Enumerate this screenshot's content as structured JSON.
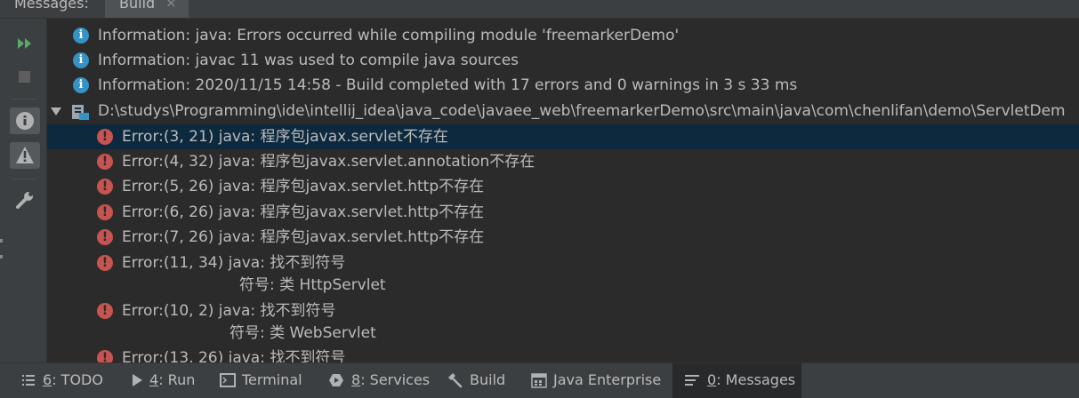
{
  "header": {
    "title": "Messages:",
    "tab_label": "Build",
    "tab_close": "×"
  },
  "toolbar": {
    "buttons": [
      {
        "name": "rerun",
        "icon": "run-double-arrow-icon",
        "color": "#59a869"
      },
      {
        "name": "stop",
        "icon": "stop-icon",
        "color": "#5e5e5e"
      },
      {
        "name": "show-info",
        "icon": "info-icon",
        "selected": true
      },
      {
        "name": "show-warnings",
        "icon": "warning-icon",
        "selected": true
      },
      {
        "name": "settings",
        "icon": "wrench-icon"
      }
    ]
  },
  "messages": {
    "info": [
      {
        "text": "Information: java: Errors occurred while compiling module 'freemarkerDemo'"
      },
      {
        "text": "Information: javac 11 was used to compile java sources"
      },
      {
        "text": "Information: 2020/11/15 14:58 - Build completed with 17 errors and 0 warnings in 3 s 33 ms"
      }
    ],
    "file_path": "D:\\studys\\Programming\\ide\\intellij_idea\\java_code\\javaee_web\\freemarkerDemo\\src\\main\\java\\com\\chenlifan\\demo\\ServletDem",
    "errors": [
      {
        "text": "Error:(3, 21)  java: 程序包javax.servlet不存在",
        "selected": true
      },
      {
        "text": "Error:(4, 32)  java: 程序包javax.servlet.annotation不存在"
      },
      {
        "text": "Error:(5, 26)  java: 程序包javax.servlet.http不存在"
      },
      {
        "text": "Error:(6, 26)  java: 程序包javax.servlet.http不存在"
      },
      {
        "text": "Error:(7, 26)  java: 程序包javax.servlet.http不存在"
      },
      {
        "text": "Error:(11, 34)  java: 找不到符号",
        "continuation": "符号: 类 HttpServlet"
      },
      {
        "text": "Error:(10, 2)  java: 找不到符号",
        "continuation": "符号: 类 WebServlet"
      },
      {
        "text": "Error:(13, 26)  java: 找不到符号"
      }
    ],
    "colors": {
      "info_icon": "#3592c4",
      "error_icon": "#c75450",
      "selection": "#0d293e"
    }
  },
  "bottombar": {
    "items": [
      {
        "num": "6",
        "label": ": TODO",
        "icon": "list-icon"
      },
      {
        "num": "4",
        "label": ": Run",
        "icon": "play-icon"
      },
      {
        "num": "",
        "label": "Terminal",
        "icon": "terminal-icon"
      },
      {
        "num": "8",
        "label": ": Services",
        "icon": "services-icon"
      },
      {
        "num": "",
        "label": "Build",
        "icon": "hammer-icon"
      },
      {
        "num": "",
        "label": "Java Enterprise",
        "icon": "java-enterprise-icon"
      },
      {
        "num": "0",
        "label": ": Messages",
        "icon": "messages-icon",
        "active": true
      }
    ]
  }
}
